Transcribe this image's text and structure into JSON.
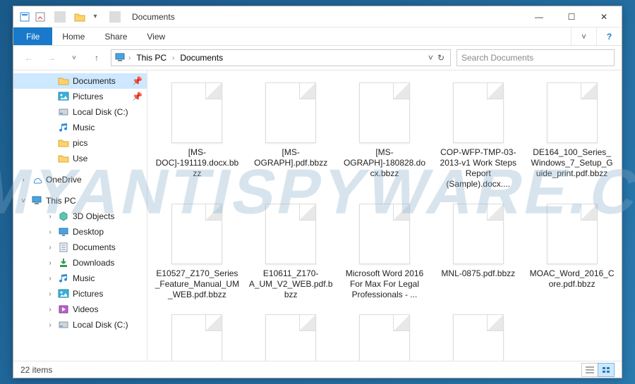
{
  "titlebar": {
    "title": "Documents"
  },
  "sysbtns": {
    "min": "—",
    "max": "☐",
    "close": "✕"
  },
  "ribbon": {
    "file": "File",
    "tabs": [
      "Home",
      "Share",
      "View"
    ],
    "expand": "˅",
    "help": "?"
  },
  "address": {
    "back": "←",
    "fwd": "→",
    "recent": "˅",
    "up": "↑",
    "crumbs": [
      "This PC",
      "Documents"
    ],
    "refresh": "↻",
    "dd": "˅"
  },
  "search": {
    "placeholder": "Search Documents"
  },
  "nav": {
    "quick": [
      {
        "label": "Documents",
        "icon": "folder",
        "sel": true,
        "pin": true
      },
      {
        "label": "Pictures",
        "icon": "pictures",
        "pin": true
      },
      {
        "label": "Local Disk (C:)",
        "icon": "disk"
      },
      {
        "label": "Music",
        "icon": "music"
      },
      {
        "label": "pics",
        "icon": "folder"
      },
      {
        "label": "Use",
        "icon": "folder"
      }
    ],
    "onedrive": {
      "label": "OneDrive",
      "tw": "›"
    },
    "thispc": {
      "label": "This PC",
      "tw": "˅",
      "items": [
        {
          "label": "3D Objects",
          "icon": "3d"
        },
        {
          "label": "Desktop",
          "icon": "desktop"
        },
        {
          "label": "Documents",
          "icon": "documents"
        },
        {
          "label": "Downloads",
          "icon": "downloads"
        },
        {
          "label": "Music",
          "icon": "music"
        },
        {
          "label": "Pictures",
          "icon": "pictures"
        },
        {
          "label": "Videos",
          "icon": "videos"
        },
        {
          "label": "Local Disk (C:)",
          "icon": "disk"
        }
      ]
    }
  },
  "files": [
    "[MS-DOC]-191119.docx.bbzz",
    "[MS-OGRAPH].pdf.bbzz",
    "[MS-OGRAPH]-180828.docx.bbzz",
    "COP-WFP-TMP-03-2013-v1 Work Steps Report (Sample).docx....",
    "DE164_100_Series_Windows_7_Setup_Guide_print.pdf.bbzz",
    "E10527_Z170_Series_Feature_Manual_UM_WEB.pdf.bbzz",
    "E10611_Z170-A_UM_V2_WEB.pdf.bbzz",
    "Microsoft Word 2016 For Max For Legal Professionals - ...",
    "MNL-0875.pdf.bbzz",
    "MOAC_Word_2016_Core.pdf.bbzz"
  ],
  "extra_placeholder_count": 4,
  "status": {
    "count": "22 items"
  },
  "watermark": "MYANTISPYWARE.COM"
}
